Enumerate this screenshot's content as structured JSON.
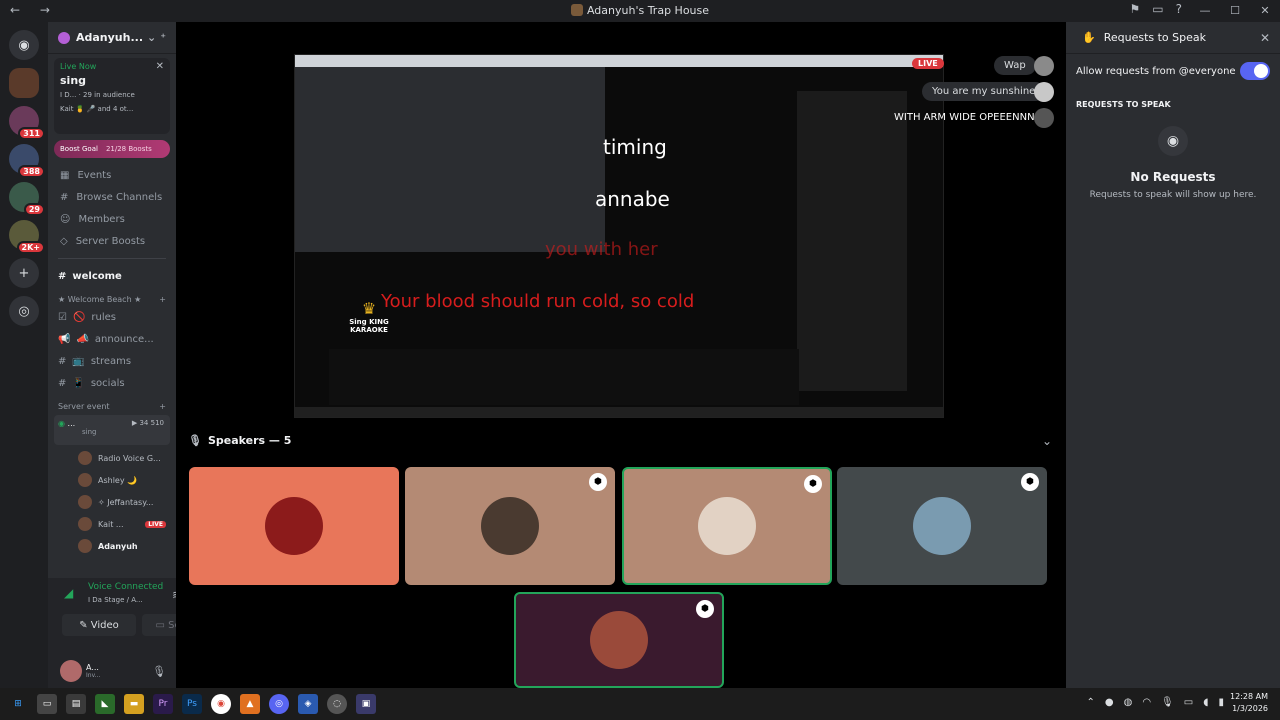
{
  "window": {
    "title": "Adanyuh's Trap House"
  },
  "titlebar_icons": [
    "inbox-icon",
    "monitor-icon",
    "help-icon"
  ],
  "server": {
    "name": "Adanyuh..."
  },
  "guild_badges": [
    "311",
    "388",
    "29",
    "2K+"
  ],
  "live_now": {
    "label": "Live Now",
    "name": "sing",
    "sub": "I D... · 29 in audience",
    "members": "Kait 🍍 🎤 and 4 ot..."
  },
  "boost": {
    "label": "Boost Goal",
    "progress": "21/28 Boosts",
    "fill": 0.75
  },
  "menu": [
    {
      "label": "Events",
      "icon": "calendar-icon"
    },
    {
      "label": "Browse Channels",
      "icon": "browse-icon"
    },
    {
      "label": "Members",
      "icon": "members-icon"
    },
    {
      "label": "Server Boosts",
      "icon": "boost-icon"
    }
  ],
  "welcome": "welcome",
  "category1": "★ Welcome Beach ★",
  "channels": [
    {
      "label": "rules",
      "emoji": "🚫"
    },
    {
      "label": "announce...",
      "emoji": "📣"
    },
    {
      "label": "streams",
      "emoji": "📺"
    },
    {
      "label": "socials",
      "emoji": "📱"
    }
  ],
  "category2": "Server event",
  "voice_channel": {
    "name": "...",
    "sub": "sing",
    "cam": "34",
    "count": "510"
  },
  "voice_members": [
    {
      "name": "Radio Voice G..."
    },
    {
      "name": "Ashley 🌙"
    },
    {
      "name": "✧ Jeffantasy..."
    },
    {
      "name": "Kait ..."
    },
    {
      "name": "Adanyuh"
    }
  ],
  "live_badge": "LIVE",
  "voice_bar": {
    "status": "Voice Connected",
    "where": "I Da Stage / A...",
    "video": "Video",
    "screen": "Screen"
  },
  "user": {
    "name": "A...",
    "status": "Inv..."
  },
  "stream": {
    "live": "LIVE",
    "lines": [
      "timing",
      "annabe",
      "you with her",
      "Your blood should run cold, so cold"
    ],
    "logo": "Sing KING KARAOKE"
  },
  "overlay": [
    {
      "text": "Wap"
    },
    {
      "text": "You are my sunshine"
    },
    {
      "text": "WITH ARM WIDE OPEEENNN"
    }
  ],
  "speakers": {
    "label": "Speakers — 5"
  },
  "tiles": [
    {
      "bg": "#e8765a",
      "avatar": "#8c1b1b"
    },
    {
      "bg": "#b48a74",
      "avatar": "#4a3a30"
    },
    {
      "bg": "#b48a74",
      "avatar": "#e2d2c4"
    },
    {
      "bg": "#43494b",
      "avatar": "#7a9bb0"
    },
    {
      "bg": "#3a1a2e",
      "avatar": "#9a4a3a"
    }
  ],
  "panel": {
    "title": "Requests to Speak",
    "allow": "Allow requests from @everyone",
    "section": "REQUESTS TO SPEAK",
    "empty_title": "No Requests",
    "empty_sub": "Requests to speak will show up here."
  },
  "clock": {
    "time": "12:28 AM",
    "date": "1/3/2026"
  }
}
